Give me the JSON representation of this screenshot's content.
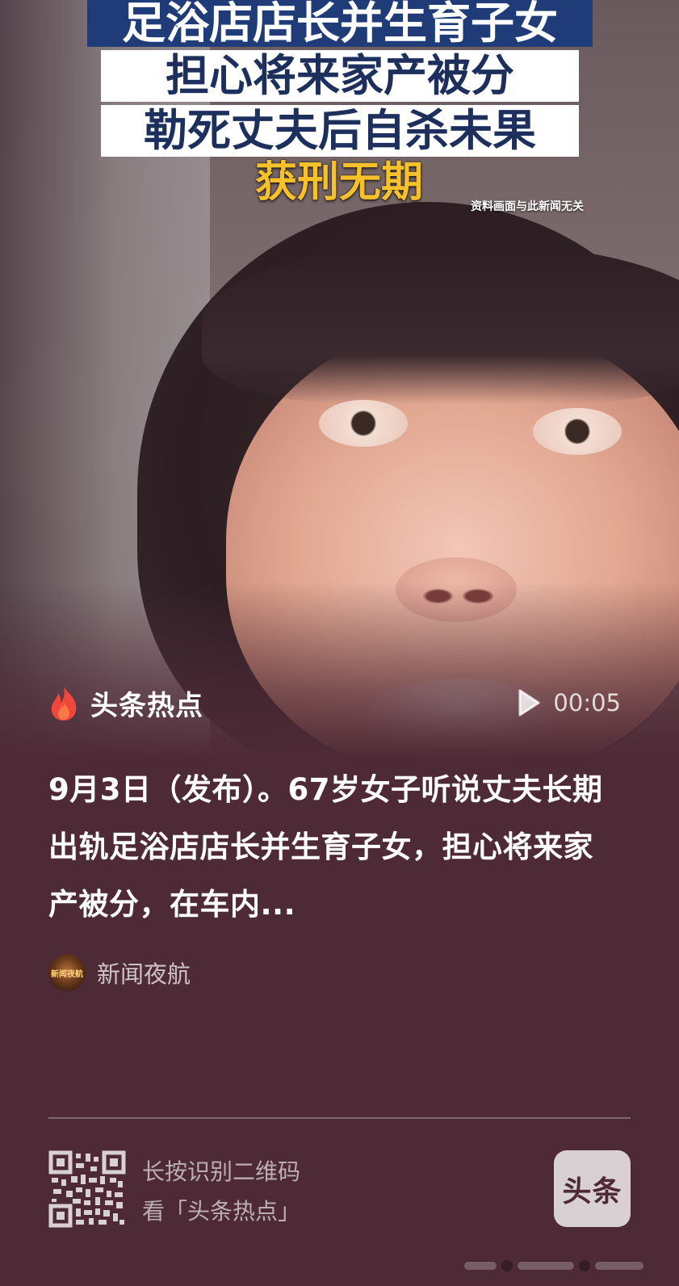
{
  "video": {
    "headline": {
      "line1": "足浴店店长并生育子女",
      "line2": "担心将来家产被分",
      "line3": "勒死丈夫后自杀未果",
      "line4": "获刑无期"
    },
    "disclaimer": "资料画面与此新闻无关",
    "brand_name": "头条热点",
    "brand_icon": "flame-icon",
    "duration": "00:05",
    "play_icon": "play-icon"
  },
  "card": {
    "summary": "9月3日（发布）。67岁女子听说丈夫长期出轨足浴店店长并生育子女，担心将来家产被分，在车内...",
    "source": {
      "avatar_text": "新闻夜航",
      "name": "新闻夜航"
    }
  },
  "footer": {
    "qr_hint_line1": "长按识别二维码",
    "qr_hint_line2": "看「头条热点」",
    "logo_text": "头条"
  },
  "colors": {
    "background": "#4e2a36",
    "headline_blue": "#1f3c79",
    "headline_yellow": "#f6c12b",
    "flame": "#f0473a"
  }
}
